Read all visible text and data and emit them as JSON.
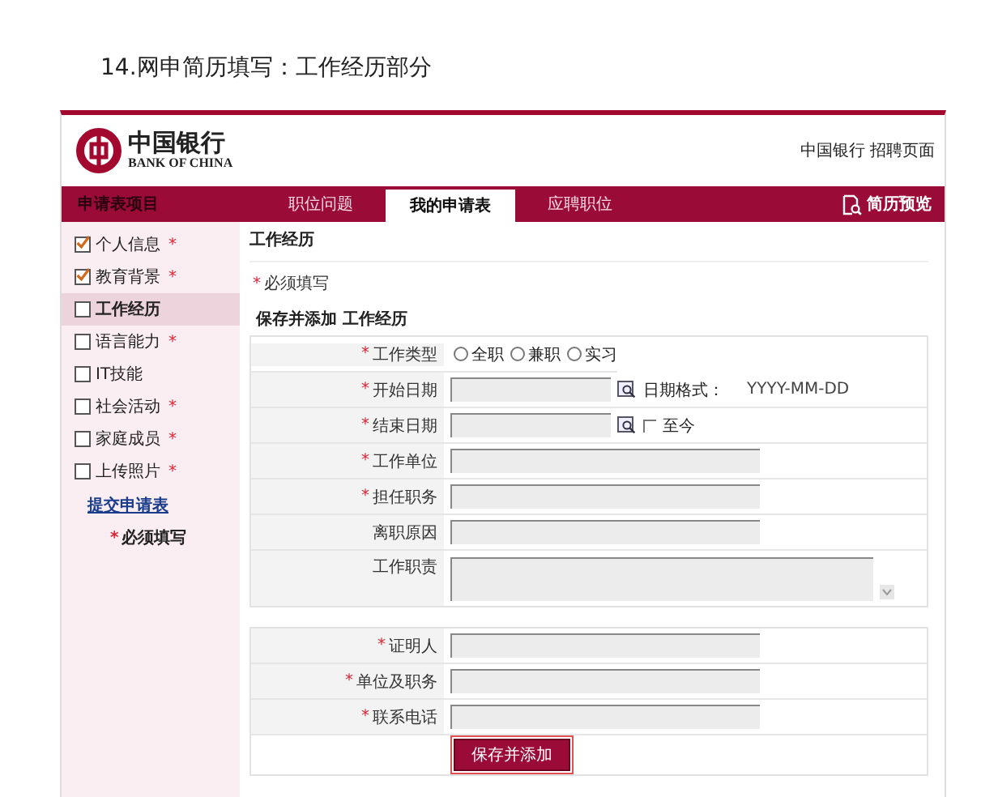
{
  "caption": "14.网申简历填写：工作经历部分",
  "header": {
    "logo_cn": "中国银行",
    "logo_en": "BANK OF CHINA",
    "link": "中国银行 招聘页面"
  },
  "nav": {
    "section_label": "申请表项目",
    "tabs": [
      {
        "label": "职位问题",
        "selected": false
      },
      {
        "label": "我的申请表",
        "selected": true
      },
      {
        "label": "应聘职位",
        "selected": false
      }
    ],
    "preview": "简历预览"
  },
  "sidebar": {
    "items": [
      {
        "label": "个人信息",
        "mark": "*",
        "checked": true,
        "selected": false
      },
      {
        "label": "教育背景",
        "mark": "*",
        "checked": true,
        "selected": false
      },
      {
        "label": "工作经历",
        "checked": false,
        "selected": true
      },
      {
        "label": "语言能力",
        "mark": "*",
        "checked": false,
        "selected": false
      },
      {
        "label": "IT技能",
        "checked": false,
        "selected": false
      },
      {
        "label": "社会活动",
        "mark": "*",
        "checked": false,
        "selected": false
      },
      {
        "label": "家庭成员",
        "mark": "*",
        "checked": false,
        "selected": false
      },
      {
        "label": "上传照片",
        "mark": "*",
        "checked": false,
        "selected": false
      }
    ],
    "submit_link": "提交申请表",
    "note": {
      "mark": "*",
      "text": "必须填写"
    }
  },
  "main": {
    "title": "工作经历",
    "note": {
      "mark": "*",
      "text": "必须填写"
    },
    "form_title": "保存并添加 工作经历",
    "groups": [
      [
        {
          "kind": "radio",
          "mark": "*",
          "label": "工作类型",
          "options": [
            {
              "label": "全职",
              "selected": false
            },
            {
              "label": "兼职",
              "selected": false
            },
            {
              "label": "实习",
              "selected": false
            }
          ]
        },
        {
          "kind": "date",
          "mark": "*",
          "label": "开始日期",
          "hint_label": "日期格式：",
          "hint": "YYYY-MM-DD"
        },
        {
          "kind": "date",
          "mark": "*",
          "label": "结束日期",
          "checkbox": {
            "label": "至今",
            "checked": false
          }
        },
        {
          "kind": "text",
          "mark": "*",
          "label": "工作单位"
        },
        {
          "kind": "text",
          "mark": "*",
          "label": "担任职务"
        },
        {
          "kind": "text",
          "label": "离职原因"
        },
        {
          "kind": "textarea",
          "label": "工作职责"
        }
      ],
      [
        {
          "kind": "text",
          "mark": "*",
          "label": "证明人"
        },
        {
          "kind": "text",
          "mark": "*",
          "label": "单位及职务"
        },
        {
          "kind": "text",
          "mark": "*",
          "label": "联系电话"
        }
      ]
    ],
    "button": "保存并添加"
  }
}
